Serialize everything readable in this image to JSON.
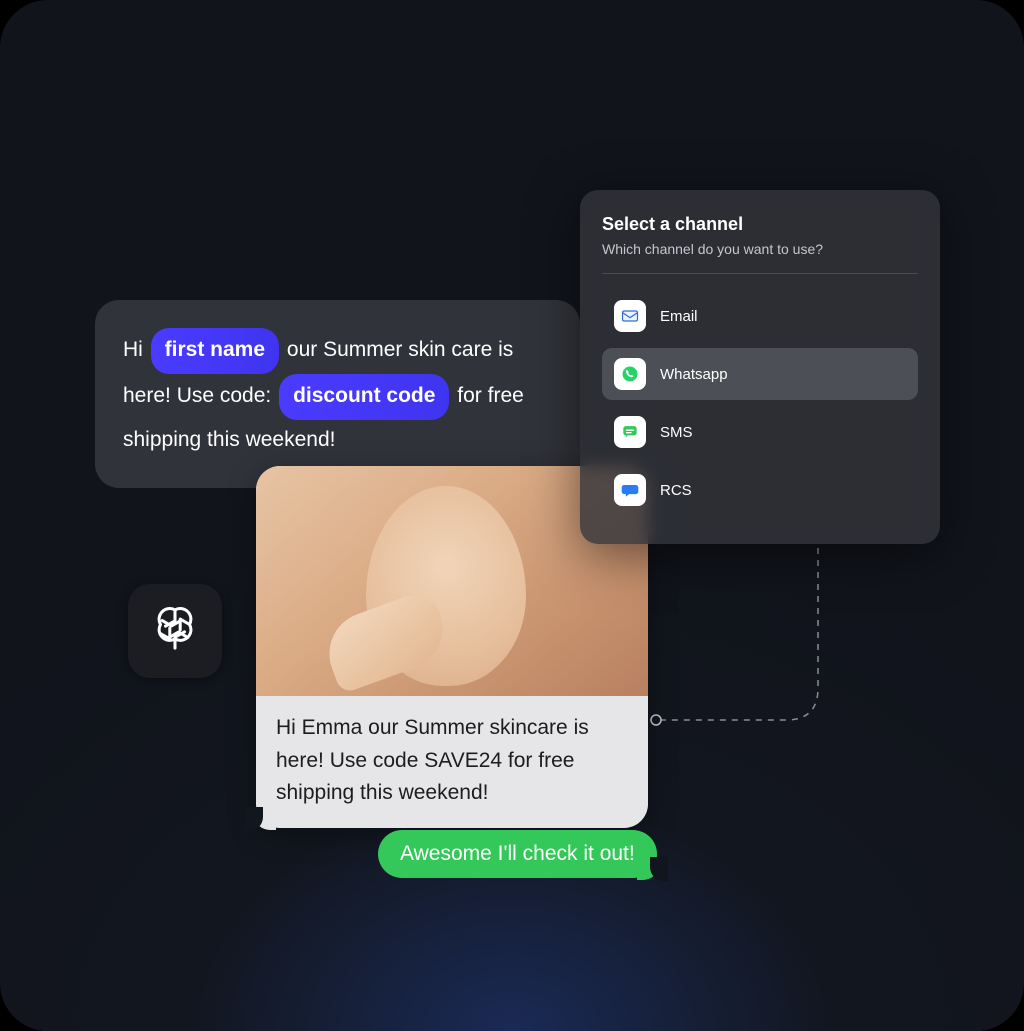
{
  "template": {
    "text_before_chip1": "Hi ",
    "chip1": "first name",
    "text_between_1": " our Summer skin care is here! Use code: ",
    "chip2": "discount code",
    "text_after": " for free shipping this weekend!"
  },
  "ai_badge": {
    "icon_name": "openai-icon"
  },
  "chat": {
    "caption": "Hi Emma our Summer skincare is here! Use code SAVE24 for free shipping this weekend!"
  },
  "reply": {
    "text": "Awesome I'll check it out!"
  },
  "channel_panel": {
    "title": "Select a channel",
    "subtitle": "Which channel do you want to use?",
    "items": [
      {
        "label": "Email",
        "selected": false,
        "icon": "email-icon",
        "icon_bg": "#ffffff",
        "icon_color": "#2b6fd8"
      },
      {
        "label": "Whatsapp",
        "selected": true,
        "icon": "whatsapp-icon",
        "icon_bg": "#ffffff",
        "icon_color": "#25d366"
      },
      {
        "label": "SMS",
        "selected": false,
        "icon": "sms-icon",
        "icon_bg": "#ffffff",
        "icon_color": "#34c759"
      },
      {
        "label": "RCS",
        "selected": false,
        "icon": "rcs-icon",
        "icon_bg": "#ffffff",
        "icon_color": "#2a7bf6"
      }
    ]
  }
}
